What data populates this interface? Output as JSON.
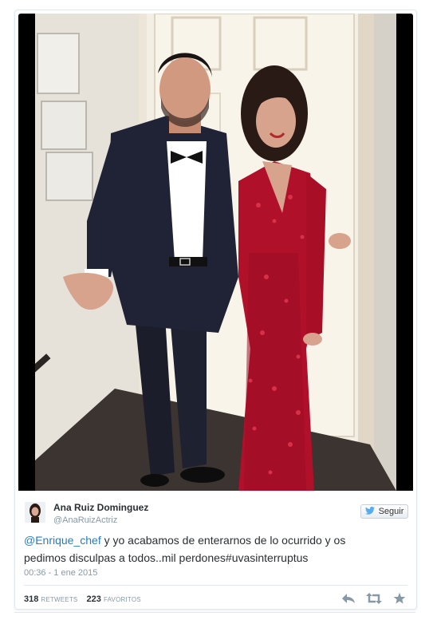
{
  "tweet": {
    "author_name": "Ana Ruiz Dominguez",
    "author_handle": "@AnaRuizActriz",
    "follow_label": "Seguir",
    "mention": "@Enrique_chef",
    "text_line_1": " y yo acabamos de enterarnos de lo ocurrido y os",
    "text_line_2": "pedimos disculpas a todos..mil perdones#uvasinterruptus",
    "timestamp": "00:36 - 1 ene 2015",
    "retweets_count": "318",
    "retweets_label": "RETWEETS",
    "favorites_count": "223",
    "favorites_label": "FAVORITOS"
  },
  "icons": {
    "follow": "twitter-bird-icon",
    "reply": "reply-icon",
    "retweet": "retweet-icon",
    "favorite": "star-icon"
  },
  "colors": {
    "link": "#2b7bb9",
    "twitter_blue": "#55acee",
    "muted": "#8899a6",
    "dress_red": "#b0102a"
  }
}
